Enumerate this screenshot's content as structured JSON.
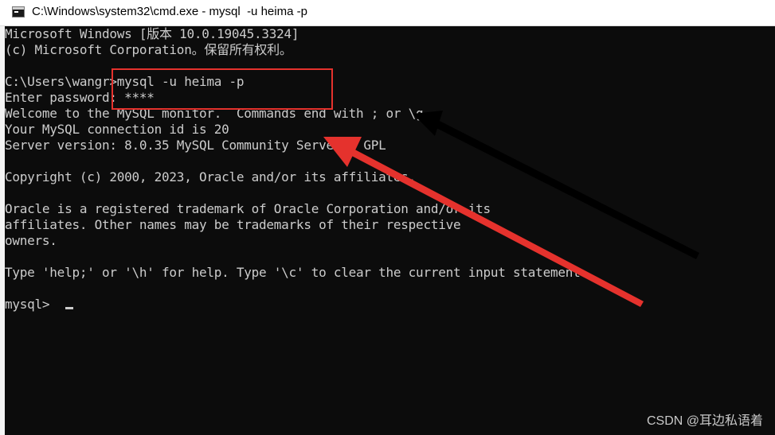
{
  "window": {
    "title": "C:\\Windows\\system32\\cmd.exe - mysql  -u heima -p"
  },
  "terminal": {
    "lines": [
      "Microsoft Windows [版本 10.0.19045.3324]",
      "(c) Microsoft Corporation。保留所有权利。",
      "",
      "C:\\Users\\wangr>mysql -u heima -p",
      "Enter password: ****",
      "Welcome to the MySQL monitor.  Commands end with ; or \\g.",
      "Your MySQL connection id is 20",
      "Server version: 8.0.35 MySQL Community Server - GPL",
      "",
      "Copyright (c) 2000, 2023, Oracle and/or its affiliates.",
      "",
      "Oracle is a registered trademark of Oracle Corporation and/or its",
      "affiliates. Other names may be trademarks of their respective",
      "owners.",
      "",
      "Type 'help;' or '\\h' for help. Type '\\c' to clear the current input statement.",
      ""
    ],
    "prompt": "mysql> "
  },
  "annotation": {
    "box_color": "#e5322d",
    "red_arrow_color": "#e5322d",
    "black_arrow_color": "#000000"
  },
  "watermark": "CSDN @耳边私语着"
}
